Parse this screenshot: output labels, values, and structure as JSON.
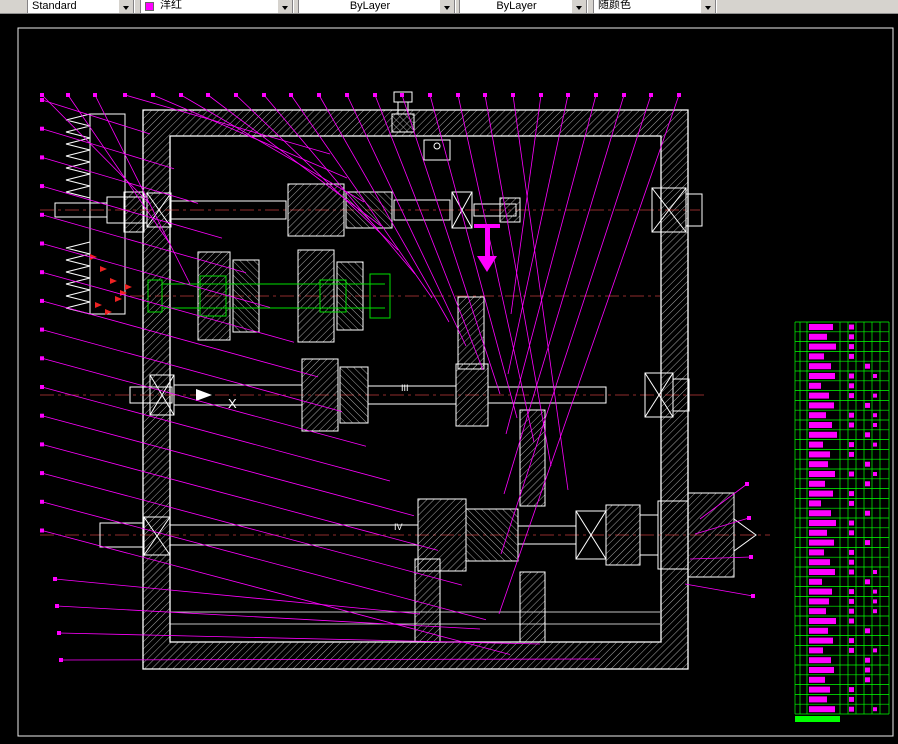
{
  "toolbar": {
    "style_combo": {
      "value": "Standard"
    },
    "color_combo": {
      "value": "洋红",
      "swatch_color": "#FF00FF"
    },
    "linetype_combo": {
      "value": "ByLayer"
    },
    "lineweight_combo": {
      "value": "ByLayer"
    },
    "plotstyle_combo": {
      "value": "随颜色"
    }
  },
  "canvas": {
    "background": "#000000",
    "colors": {
      "outline": "#FFFFFF",
      "leaders": "#FF00FF",
      "centerline": "#C03A3A",
      "shaft_green": "#00E000",
      "table_green": "#00FF00"
    },
    "labels": {
      "shaft3": "III",
      "shaft4": "IV",
      "section": "X"
    }
  },
  "parts_table": {
    "block_widths": [
      24,
      18,
      27,
      15,
      22,
      26,
      12,
      20,
      25,
      17,
      23,
      28,
      14,
      21,
      19,
      26,
      16,
      24,
      12,
      22,
      27,
      18,
      25,
      15,
      21,
      26,
      13,
      23,
      20,
      17,
      27,
      19,
      24,
      14,
      22,
      25,
      16,
      21,
      18,
      26
    ]
  }
}
